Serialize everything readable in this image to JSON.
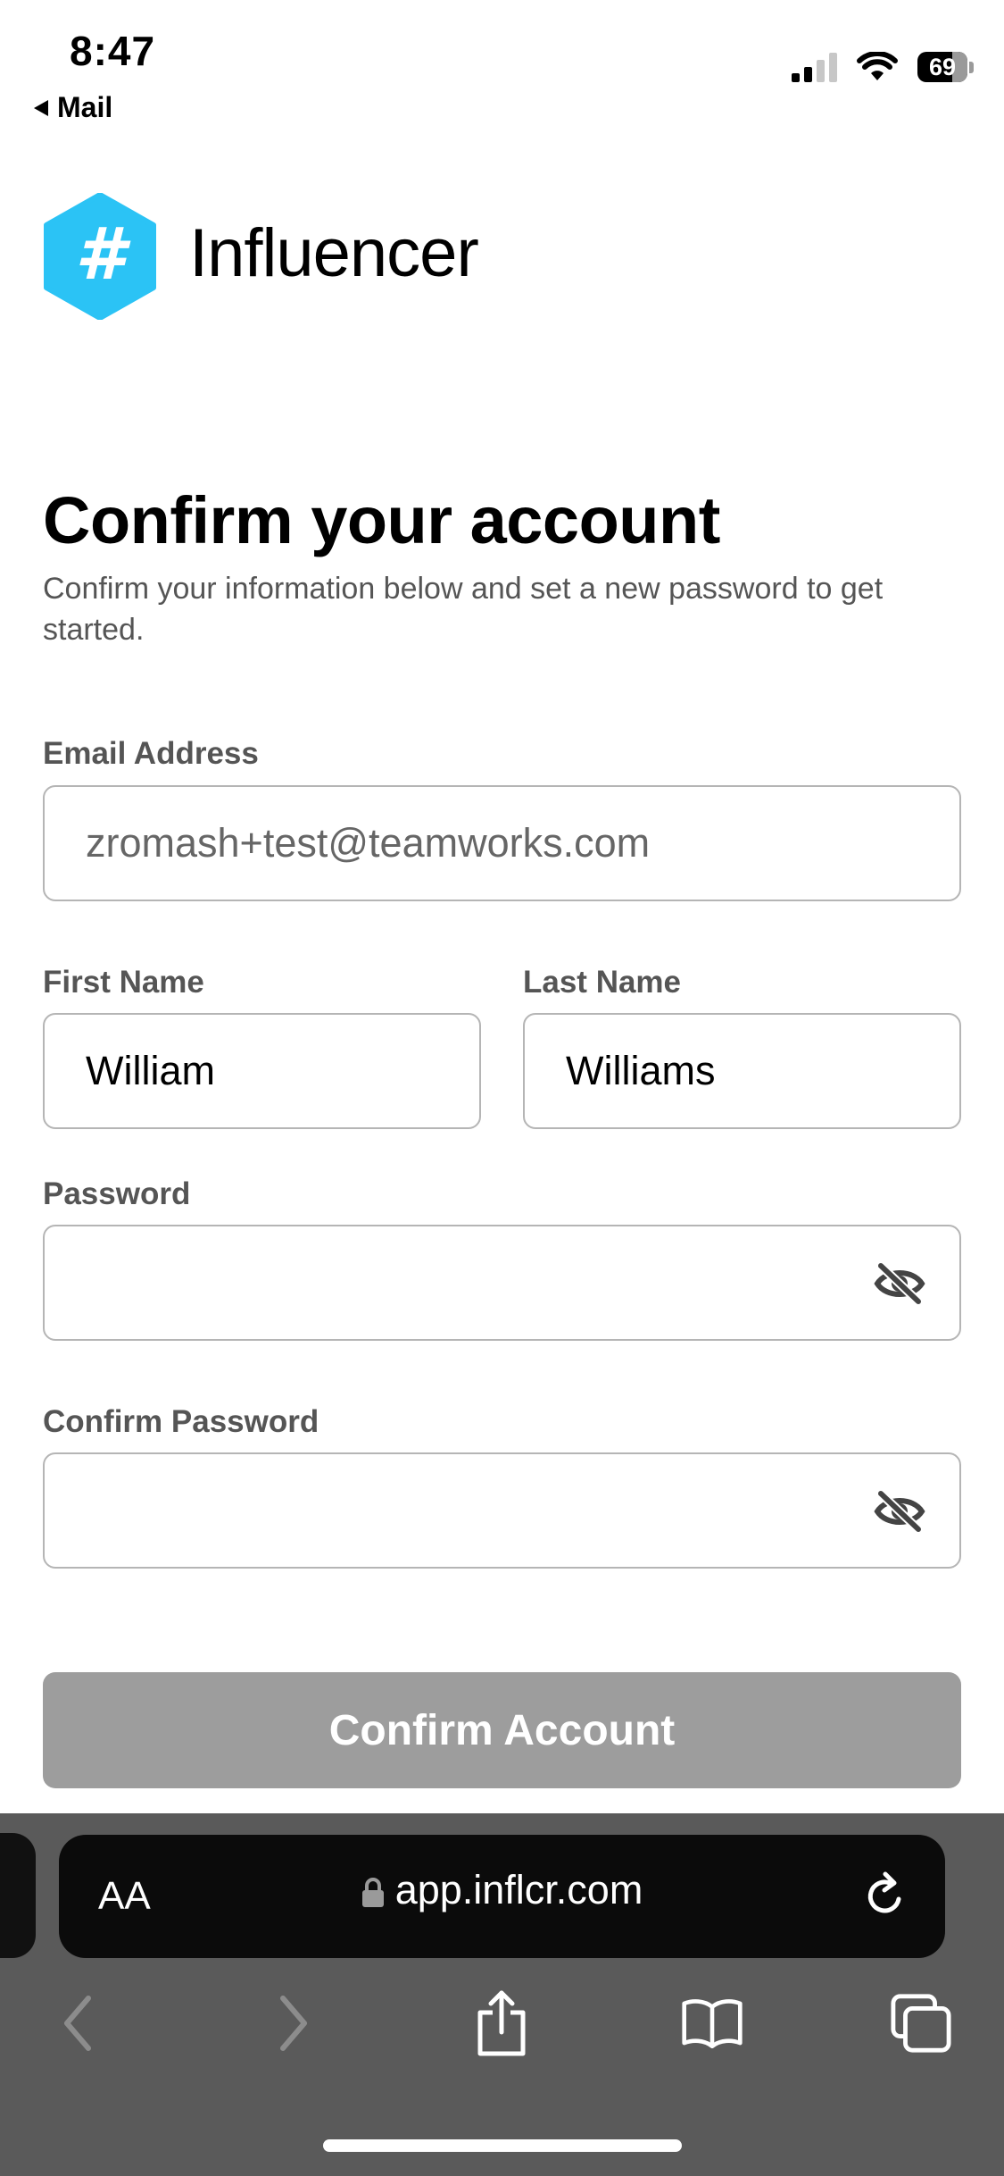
{
  "status_bar": {
    "time": "8:47",
    "back_app": "Mail",
    "battery": "69"
  },
  "brand": {
    "logo_symbol": "#",
    "name": "Influencer",
    "logo_color": "#2bc3f5"
  },
  "heading": {
    "title": "Confirm your account",
    "subtitle": "Confirm your information below and set a new password to get started."
  },
  "form": {
    "email_label": "Email Address",
    "email_value": "zromash+test@teamworks.com",
    "first_name_label": "First Name",
    "first_name_value": "William",
    "last_name_label": "Last Name",
    "last_name_value": "Williams",
    "password_label": "Password",
    "confirm_password_label": "Confirm Password",
    "submit_label": "Confirm Account"
  },
  "browser": {
    "text_size_label": "AA",
    "url": "app.inflcr.com",
    "toolbar_icons": [
      "back-icon",
      "forward-icon",
      "share-icon",
      "bookmarks-icon",
      "tabs-icon"
    ]
  }
}
